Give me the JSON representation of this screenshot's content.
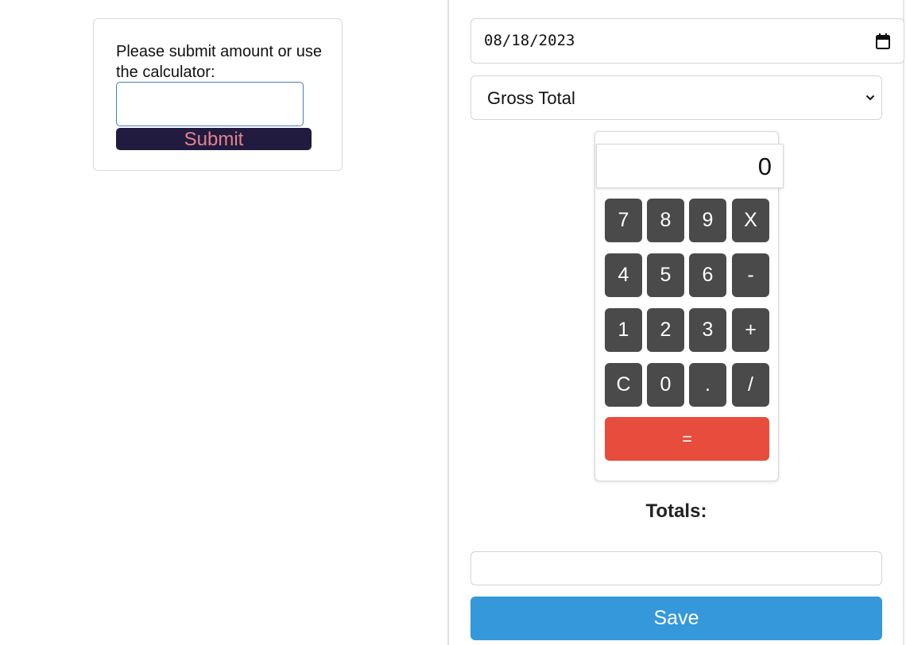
{
  "submit_panel": {
    "prompt": "Please submit amount or use the calculator:",
    "amount_value": "",
    "submit_label": "Submit"
  },
  "right_panel": {
    "date_value": "08/18/2023",
    "calendar_icon": "calendar-icon",
    "select_value": "Gross Total",
    "select_icon": "chevron-down-icon"
  },
  "calculator": {
    "display": "0",
    "keys": [
      [
        "7",
        "8",
        "9",
        "X"
      ],
      [
        "4",
        "5",
        "6",
        "-"
      ],
      [
        "1",
        "2",
        "3",
        "+"
      ],
      [
        "C",
        "0",
        ".",
        "/"
      ]
    ],
    "equals_label": "="
  },
  "totals": {
    "label": "Totals:",
    "value": "",
    "save_label": "Save"
  },
  "colors": {
    "submit_bg": "#211b3f",
    "submit_text": "#e4838b",
    "key_bg": "#4a4a4a",
    "equals_bg": "#e74c3c",
    "save_bg": "#3498db"
  }
}
